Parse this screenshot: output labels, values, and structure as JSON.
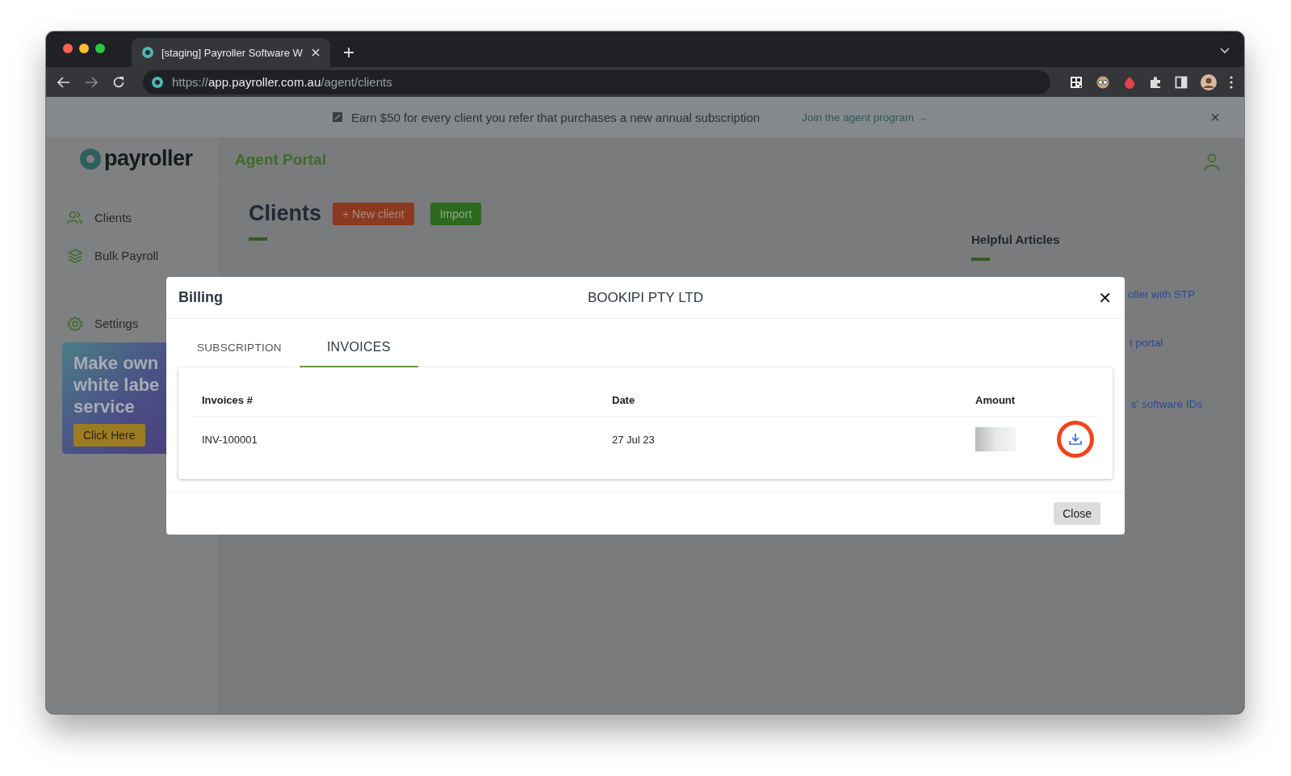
{
  "browser": {
    "tab_title": "[staging] Payroller Software W",
    "url": {
      "scheme": "https://",
      "host": "app.payroller.com.au",
      "path": "/agent/clients"
    }
  },
  "banner": {
    "text": "Earn $50 for every client you refer that purchases a new annual subscription",
    "link": "Join the agent program →",
    "close": "×"
  },
  "header": {
    "logo": "payroller",
    "portal_title": "Agent Portal"
  },
  "sidebar": {
    "items": [
      {
        "label": "Clients",
        "kind": "people"
      },
      {
        "label": "Bulk Payroll",
        "kind": "layers"
      },
      {
        "label": "Settings",
        "kind": "settings"
      }
    ],
    "promo": {
      "lines": [
        "Make own",
        "white labe",
        "service"
      ],
      "button": "Click Here"
    }
  },
  "main": {
    "title": "Clients",
    "buttons": [
      {
        "label": "+ New client",
        "kind": "danger"
      },
      {
        "label": "Import",
        "kind": "primary"
      }
    ]
  },
  "helpful": {
    "title": "Helpful Articles",
    "links": [
      "oller with STP",
      "t portal",
      "s' software IDs"
    ]
  },
  "modal": {
    "title": "Billing",
    "company": "BOOKIPI PTY LTD",
    "close": "✕",
    "tabs": [
      {
        "label": "SUBSCRIPTION",
        "selected": false
      },
      {
        "label": "INVOICES",
        "selected": true
      }
    ],
    "table": {
      "columns": [
        "Invoices #",
        "Date",
        "Amount"
      ],
      "rows": [
        {
          "invoice": "INV-100001",
          "date": "27 Jul 23",
          "amount_redacted": true,
          "download_highlighted": true
        }
      ]
    },
    "footer_button": "Close"
  }
}
